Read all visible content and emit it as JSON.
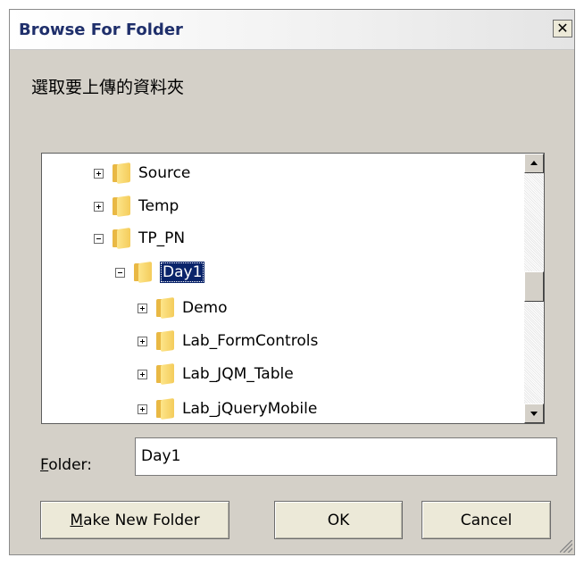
{
  "window": {
    "title": "Browse For Folder",
    "close_glyph": "✕"
  },
  "prompt": "選取要上傳的資料夾",
  "tree": {
    "items": [
      {
        "label": "Source",
        "expander": "plus",
        "level": 1,
        "selected": false
      },
      {
        "label": "Temp",
        "expander": "plus",
        "level": 1,
        "selected": false
      },
      {
        "label": "TP_PN",
        "expander": "minus",
        "level": 1,
        "selected": false
      },
      {
        "label": "Day1",
        "expander": "minus",
        "level": 2,
        "selected": true
      },
      {
        "label": "Demo",
        "expander": "plus",
        "level": 3,
        "selected": false
      },
      {
        "label": "Lab_FormControls",
        "expander": "plus",
        "level": 3,
        "selected": false
      },
      {
        "label": "Lab_JQM_Table",
        "expander": "plus",
        "level": 3,
        "selected": false
      },
      {
        "label": "Lab_jQueryMobile",
        "expander": "plus",
        "level": 3,
        "selected": false
      }
    ]
  },
  "folder": {
    "label_accel": "F",
    "label_rest": "older:",
    "value": "Day1"
  },
  "buttons": {
    "make_new_folder_accel": "M",
    "make_new_folder_rest": "ake New Folder",
    "ok": "OK",
    "cancel": "Cancel"
  },
  "colors": {
    "selection": "#0a246a",
    "dialog_bg": "#d4d0c8",
    "title_text": "#1f2f6b"
  }
}
